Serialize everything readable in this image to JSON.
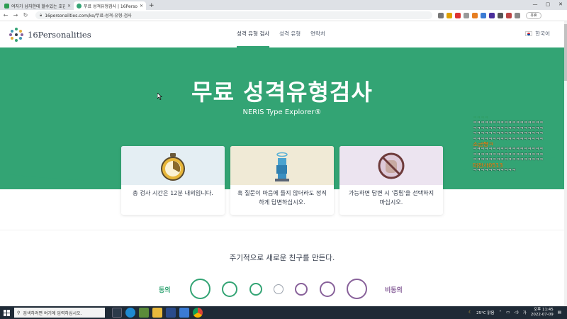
{
  "browser": {
    "tabs": [
      {
        "title": "여자가 남자한테 할수있는 호감",
        "favicon_color": "#2e9d52",
        "active": false
      },
      {
        "title": "무료 성격유형검사 | 16Personali",
        "favicon_color": "#33a474",
        "active": true
      }
    ],
    "new_tab": "+",
    "url": "16personalities.com/ko/무료-성격-유형-검사",
    "profile_label": "유휴",
    "window_controls": [
      "—",
      "▢",
      "✕"
    ]
  },
  "site": {
    "logo_text": "16Personalities",
    "nav": [
      {
        "label": "성격 유형 검사",
        "active": true
      },
      {
        "label": "성격 유형",
        "active": false
      },
      {
        "label": "연락처",
        "active": false
      }
    ],
    "language": "한국어"
  },
  "hero": {
    "title": "무료 성격유형검사",
    "subtitle": "NERIS Type Explorer®",
    "background": "#33a474"
  },
  "cards": [
    {
      "icon": "stopwatch-icon",
      "text": "총 검사 시간은 12분 내외입니다."
    },
    {
      "icon": "honest-statue-icon",
      "text": "혹 질문이 마음에 들지 않더라도 정직하게 답변하십시오."
    },
    {
      "icon": "no-neutral-icon",
      "text": "가능하면 답변 시 '중립'을 선택하지 마십시오."
    }
  ],
  "question": {
    "text": "주기적으로 새로운 친구를 만든다.",
    "agree_label": "동의",
    "disagree_label": "비동의",
    "agree_color": "#33a474",
    "disagree_color": "#88619a",
    "option_count": 7
  },
  "overlay": [
    {
      "text": "ㅋㅋㅋㅋ",
      "style": "green"
    },
    {
      "text": "ㅋㅋㅋㅋㅋㅋㅋㅋㅋㅋㅋㅋㅋㅋㅋㅋㅋㅋ",
      "style": "white"
    },
    {
      "text": "ㅋㅋㅋㅋㅋㅋㅋㅋㅋㅋㅋㅋㅋㅋㅋㅋㅋㅋ",
      "style": "white"
    },
    {
      "text": "ㅋㅋㅋㅋㅋㅋㅋㅋㅋㅋㅋㅋㅋㅋㅋㅋㅋㅋ",
      "style": "white"
    },
    {
      "text": "ㅋㅋㅋㅋㅋㅋㅋㅋㅋㅋㅋㅋㅋㅋㅋㅋㅋㅋ",
      "style": "white"
    },
    {
      "text": "소금쨩ㅋ",
      "style": "orange"
    },
    {
      "text": "ㅋㅋㅋㅋㅋㅋㅋㅋㅋㅋㅋㅋㅋㅋㅋㅋㅋㅋ",
      "style": "white"
    },
    {
      "text": "ㅋㅋㅋㅋㅋㅋㅋㅋㅋㅋㅋㅋㅋㅋㅋㅋㅋㅋ",
      "style": "white"
    },
    {
      "text": "ㅋㅋㅋㅋㅋㅋㅋㅋㅋㅋㅋㅋㅋㅋㅋㅋㅋㅋ",
      "style": "white"
    },
    {
      "text": "대천사0513",
      "style": "orange"
    },
    {
      "text": "ㅋㅋㅋㅋㅋㅋㅋㅋㅋㅋㅋ",
      "style": "white"
    }
  ],
  "taskbar": {
    "search_placeholder": "검색하려면 여기에 입력하십시오.",
    "weather": "25°C 맑음",
    "time": "오후 11:45",
    "date": "2022-07-09"
  }
}
